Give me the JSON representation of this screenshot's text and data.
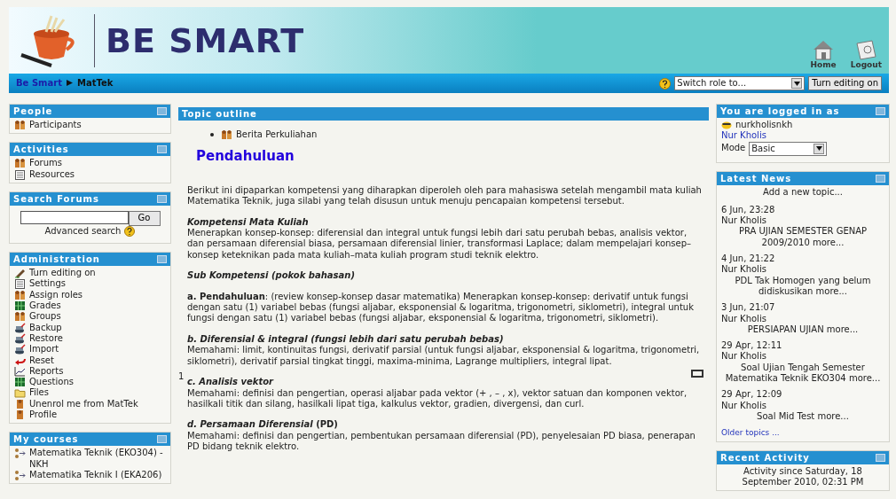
{
  "header": {
    "logo_text": "BE SMART",
    "buttons": [
      {
        "label": "Home",
        "kind": "home"
      },
      {
        "label": "Logout",
        "kind": "logout"
      }
    ]
  },
  "navbar": {
    "breadcrumb": [
      {
        "label": "Be Smart",
        "kind": "link"
      },
      {
        "label": "MatTek",
        "kind": "current"
      }
    ],
    "role_select": "Switch role to...",
    "editing_button": "Turn editing on"
  },
  "left_blocks": [
    {
      "title": "People",
      "kind": "links",
      "items": [
        {
          "label": "Participants",
          "kind": "people"
        }
      ]
    },
    {
      "title": "Activities",
      "kind": "links",
      "items": [
        {
          "label": "Forums",
          "kind": "people"
        },
        {
          "label": "Resources",
          "kind": "document"
        }
      ]
    },
    {
      "title": "Search Forums",
      "kind": "search",
      "button": "Go",
      "link": "Advanced search"
    },
    {
      "title": "Administration",
      "kind": "links",
      "items": [
        {
          "label": "Turn editing on",
          "kind": "pencil"
        },
        {
          "label": "Settings",
          "kind": "document"
        },
        {
          "label": "Assign roles",
          "kind": "people"
        },
        {
          "label": "Grades",
          "kind": "grid"
        },
        {
          "label": "Groups",
          "kind": "people"
        },
        {
          "label": "Backup",
          "kind": "disk"
        },
        {
          "label": "Restore",
          "kind": "disk"
        },
        {
          "label": "Import",
          "kind": "disk"
        },
        {
          "label": "Reset",
          "kind": "arrow"
        },
        {
          "label": "Reports",
          "kind": "chart"
        },
        {
          "label": "Questions",
          "kind": "grid"
        },
        {
          "label": "Files",
          "kind": "folder"
        },
        {
          "label": "Unenrol me from MatTek",
          "kind": "person"
        },
        {
          "label": "Profile",
          "kind": "person"
        }
      ]
    },
    {
      "title": "My courses",
      "kind": "links",
      "items": [
        {
          "label": "Matematika Teknik (EKO304) - NKH",
          "kind": "course"
        },
        {
          "label": "Matematika Teknik I (EKA206)",
          "kind": "course"
        }
      ]
    }
  ],
  "center": {
    "title": "Topic outline",
    "news_link": "Berita Perkuliahan",
    "section_title": "Pendahuluan",
    "section_number": "1",
    "blocks": [
      {
        "text": "Berikut ini dipaparkan kompetensi yang diharapkan diperoleh oleh para mahasiswa setelah mengambil mata kuliah Matematika Teknik, juga silabi yang telah disusun untuk menuju pencapaian kompetensi tersebut."
      },
      {
        "heading": "Kompetensi Mata Kuliah",
        "italic": true,
        "text": "Menerapkan konsep-konsep: diferensial dan integral untuk fungsi lebih dari satu perubah bebas, analisis vektor, dan persamaan diferensial biasa, persamaan diferensial linier, transformasi Laplace; dalam mempelajari konsep–konsep keteknikan pada mata kuliah–mata kuliah program studi teknik elektro."
      },
      {
        "heading": "Sub Kompetensi (pokok bahasan)",
        "italic": true
      },
      {
        "text": "**a. Pendahuluan**: (review konsep-konsep dasar matematika) Menerapkan konsep-konsep: derivatif untuk fungsi dengan satu (1) variabel bebas (fungsi aljabar, eksponensial & logaritma, trigonometri, siklometri), integral untuk fungsi dengan satu (1) variabel bebas (fungsi aljabar, eksponensial & logaritma, trigonometri, siklometri)."
      },
      {
        "heading": "b. Diferensial & integral (fungsi lebih dari satu perubah bebas)",
        "italic": true,
        "text": "Memahami: limit, kontinuitas fungsi, derivatif parsial (untuk fungsi aljabar, eksponensial & logaritma, trigonometri, siklometri), derivatif parsial tingkat tinggi, maxima-minima, Lagrange multipliers, integral lipat."
      },
      {
        "heading": "c. Analisis vektor",
        "italic": true,
        "text": "Memahami: definisi dan pengertian, operasi aljabar pada vektor (+ , – , x), vektor satuan dan komponen vektor, hasilkali titik dan silang, hasilkali lipat tiga, kalkulus vektor, gradien, divergensi, dan curl."
      },
      {
        "heading": "*d. Persamaan Diferensial* (PD)",
        "italic": false,
        "text": "Memahami: definisi dan pengertian, pembentukan persamaan diferensial (PD), penyelesaian PD biasa, penerapan PD bidang teknik elektro."
      }
    ]
  },
  "right_blocks": [
    {
      "title": "You are logged in as",
      "kind": "login",
      "username": "nurkholisnkh",
      "name": "Nur Kholis",
      "mode_label": "Mode",
      "mode_value": "Basic"
    },
    {
      "title": "Latest News",
      "kind": "news",
      "add_link": "Add a new topic...",
      "items": [
        {
          "date": "6 Jun, 23:28",
          "author": "Nur Kholis",
          "title": "PRA UJIAN SEMESTER GENAP 2009/2010",
          "more": "more..."
        },
        {
          "date": "4 Jun, 21:22",
          "author": "Nur Kholis",
          "title": "PDL Tak Homogen yang belum didiskusikan",
          "more": "more..."
        },
        {
          "date": "3 Jun, 21:07",
          "author": "Nur Kholis",
          "title": "PERSIAPAN UJIAN",
          "more": "more..."
        },
        {
          "date": "29 Apr, 12:11",
          "author": "Nur Kholis",
          "title": "Soal Ujian Tengah Semester Matematika Teknik EKO304",
          "more": "more..."
        },
        {
          "date": "29 Apr, 12:09",
          "author": "Nur Kholis",
          "title": "Soal Mid Test",
          "more": "more..."
        }
      ],
      "older_link": "Older topics ..."
    },
    {
      "title": "Recent Activity",
      "kind": "activity",
      "text": "Activity since Saturday, 18 September 2010, 02:31 PM"
    }
  ]
}
